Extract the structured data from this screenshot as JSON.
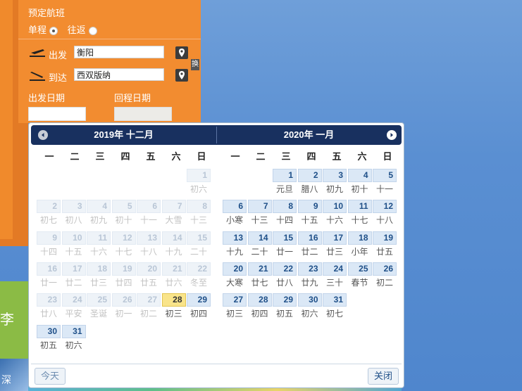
{
  "background": {
    "side_char": "李",
    "bottom_char": "深"
  },
  "booking": {
    "title": "预定航班",
    "trip_oneway": "单程",
    "trip_round": "往返",
    "depart_label": "出发",
    "arrive_label": "到达",
    "depart_city": "衡阳",
    "arrive_city": "西双版纳",
    "swap_label": "换",
    "depart_date_label": "出发日期",
    "return_date_label": "回程日期"
  },
  "calendar": {
    "left_title": "2019年 十二月",
    "right_title": "2020年 一月",
    "weekdays": [
      "一",
      "二",
      "三",
      "四",
      "五",
      "六",
      "日"
    ],
    "today_button": "今天",
    "close_button": "关闭",
    "left_cells": [
      {
        "day": "1",
        "sub": "初六",
        "state": "past"
      },
      {
        "day": "2",
        "sub": "初七",
        "state": "past"
      },
      {
        "day": "3",
        "sub": "初八",
        "state": "past"
      },
      {
        "day": "4",
        "sub": "初九",
        "state": "past"
      },
      {
        "day": "5",
        "sub": "初十",
        "state": "past"
      },
      {
        "day": "6",
        "sub": "十一",
        "state": "past"
      },
      {
        "day": "7",
        "sub": "大雪",
        "state": "past"
      },
      {
        "day": "8",
        "sub": "十三",
        "state": "past"
      },
      {
        "day": "9",
        "sub": "十四",
        "state": "past"
      },
      {
        "day": "10",
        "sub": "十五",
        "state": "past"
      },
      {
        "day": "11",
        "sub": "十六",
        "state": "past"
      },
      {
        "day": "12",
        "sub": "十七",
        "state": "past"
      },
      {
        "day": "13",
        "sub": "十八",
        "state": "past"
      },
      {
        "day": "14",
        "sub": "十九",
        "state": "past"
      },
      {
        "day": "15",
        "sub": "二十",
        "state": "past"
      },
      {
        "day": "16",
        "sub": "廿一",
        "state": "past"
      },
      {
        "day": "17",
        "sub": "廿二",
        "state": "past"
      },
      {
        "day": "18",
        "sub": "廿三",
        "state": "past"
      },
      {
        "day": "19",
        "sub": "廿四",
        "state": "past"
      },
      {
        "day": "20",
        "sub": "廿五",
        "state": "past"
      },
      {
        "day": "21",
        "sub": "廿六",
        "state": "past"
      },
      {
        "day": "22",
        "sub": "冬至",
        "state": "past"
      },
      {
        "day": "23",
        "sub": "廿八",
        "state": "past"
      },
      {
        "day": "24",
        "sub": "平安",
        "state": "past"
      },
      {
        "day": "25",
        "sub": "圣诞",
        "state": "past"
      },
      {
        "day": "26",
        "sub": "初一",
        "state": "past"
      },
      {
        "day": "27",
        "sub": "初二",
        "state": "past"
      },
      {
        "day": "28",
        "sub": "初三",
        "state": "today"
      },
      {
        "day": "29",
        "sub": "初四",
        "state": "active"
      },
      {
        "day": "30",
        "sub": "初五",
        "state": "active"
      },
      {
        "day": "31",
        "sub": "初六",
        "state": "active"
      }
    ],
    "right_cells": [
      {
        "day": "1",
        "sub": "元旦",
        "state": "active"
      },
      {
        "day": "2",
        "sub": "腊八",
        "state": "active"
      },
      {
        "day": "3",
        "sub": "初九",
        "state": "active"
      },
      {
        "day": "4",
        "sub": "初十",
        "state": "active"
      },
      {
        "day": "5",
        "sub": "十一",
        "state": "active"
      },
      {
        "day": "6",
        "sub": "小寒",
        "state": "active"
      },
      {
        "day": "7",
        "sub": "十三",
        "state": "active"
      },
      {
        "day": "8",
        "sub": "十四",
        "state": "active"
      },
      {
        "day": "9",
        "sub": "十五",
        "state": "active"
      },
      {
        "day": "10",
        "sub": "十六",
        "state": "active"
      },
      {
        "day": "11",
        "sub": "十七",
        "state": "active"
      },
      {
        "day": "12",
        "sub": "十八",
        "state": "active"
      },
      {
        "day": "13",
        "sub": "十九",
        "state": "active"
      },
      {
        "day": "14",
        "sub": "二十",
        "state": "active"
      },
      {
        "day": "15",
        "sub": "廿一",
        "state": "active"
      },
      {
        "day": "16",
        "sub": "廿二",
        "state": "active"
      },
      {
        "day": "17",
        "sub": "廿三",
        "state": "active"
      },
      {
        "day": "18",
        "sub": "小年",
        "state": "active"
      },
      {
        "day": "19",
        "sub": "廿五",
        "state": "active"
      },
      {
        "day": "20",
        "sub": "大寒",
        "state": "active"
      },
      {
        "day": "21",
        "sub": "廿七",
        "state": "active"
      },
      {
        "day": "22",
        "sub": "廿八",
        "state": "active"
      },
      {
        "day": "23",
        "sub": "廿九",
        "state": "active"
      },
      {
        "day": "24",
        "sub": "三十",
        "state": "active"
      },
      {
        "day": "25",
        "sub": "春节",
        "state": "active"
      },
      {
        "day": "26",
        "sub": "初二",
        "state": "active"
      },
      {
        "day": "27",
        "sub": "初三",
        "state": "active"
      },
      {
        "day": "28",
        "sub": "初四",
        "state": "active"
      },
      {
        "day": "29",
        "sub": "初五",
        "state": "active"
      },
      {
        "day": "30",
        "sub": "初六",
        "state": "active"
      },
      {
        "day": "31",
        "sub": "初七",
        "state": "active"
      }
    ]
  }
}
